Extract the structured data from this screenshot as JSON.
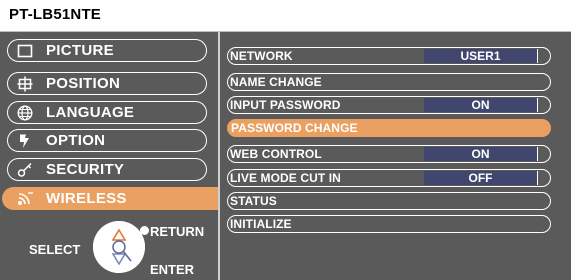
{
  "title": "PT-LB51NTE",
  "menu": [
    {
      "label": "PICTURE",
      "icon": "picture-icon"
    },
    {
      "label": "POSITION",
      "icon": "position-icon"
    },
    {
      "label": "LANGUAGE",
      "icon": "globe-icon"
    },
    {
      "label": "OPTION",
      "icon": "option-icon"
    },
    {
      "label": "SECURITY",
      "icon": "key-icon"
    },
    {
      "label": "WIRELESS",
      "icon": "wireless-icon",
      "active": true
    }
  ],
  "nav": {
    "select": "SELECT",
    "return": "RETURN",
    "enter": "ENTER"
  },
  "rows": [
    {
      "name": "NETWORK",
      "value": "USER1"
    },
    {
      "name": "NAME CHANGE",
      "value": null
    },
    {
      "name": "INPUT PASSWORD",
      "value": "ON"
    },
    {
      "name": "PASSWORD CHANGE",
      "value": null,
      "active": true
    },
    {
      "name": "WEB CONTROL",
      "value": "ON"
    },
    {
      "name": "LIVE MODE CUT IN",
      "value": "OFF"
    },
    {
      "name": "STATUS",
      "value": null
    },
    {
      "name": "INITIALIZE",
      "value": null
    }
  ],
  "colors": {
    "panel_bg": "#5a5a5a",
    "highlight": "#e9a060",
    "value_bg": "#41466e",
    "foreground": "#ffffff"
  }
}
